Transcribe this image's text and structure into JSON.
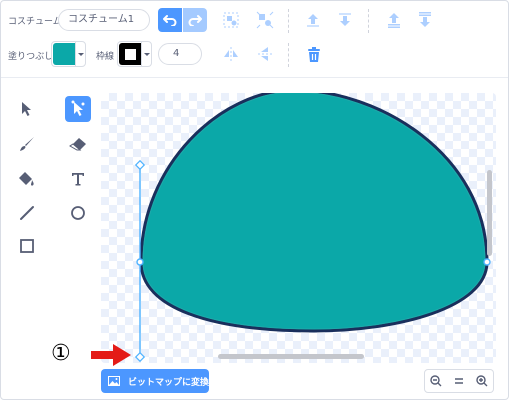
{
  "toolbar": {
    "costume_label": "コスチューム",
    "costume_name": "コスチューム1",
    "fill_label": "塗りつぶし",
    "outline_label": "枠線",
    "outline_width": "4"
  },
  "colors": {
    "accent": "#4c97ff",
    "fill": "#0ba8a8",
    "outline": "#000000",
    "shape_stroke": "#1a2f5c",
    "arrow": "#e41b17"
  },
  "tools": [
    "select",
    "reshape",
    "brush",
    "eraser",
    "fill",
    "text",
    "line",
    "circle",
    "rectangle"
  ],
  "canvas": {
    "convert_button": "ビットマップに変換"
  },
  "annotation": {
    "marker": "①"
  },
  "zoom": [
    "zoom-out",
    "zoom-reset",
    "zoom-in"
  ]
}
